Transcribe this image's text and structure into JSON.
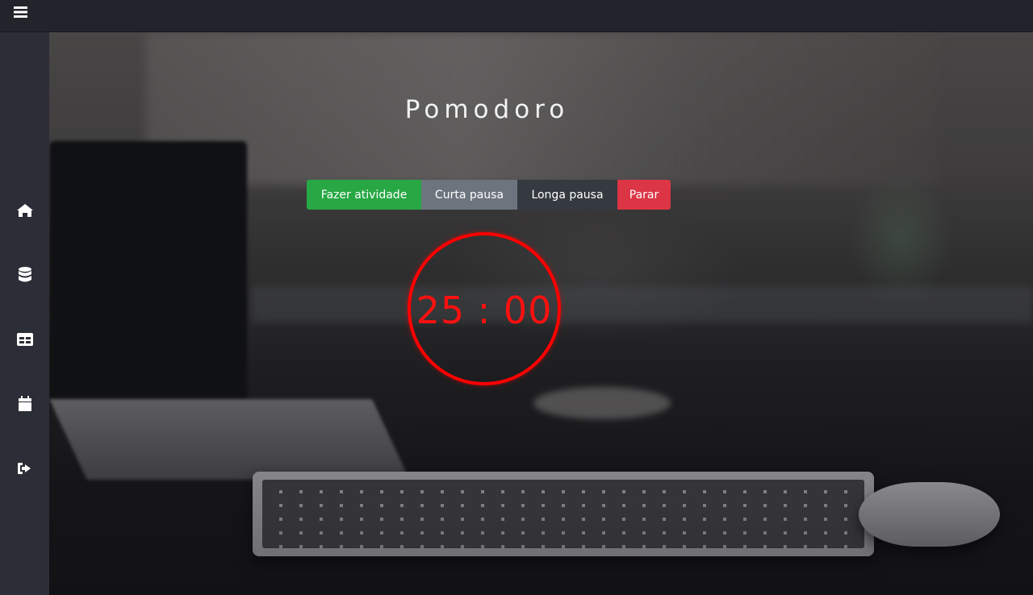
{
  "header": {
    "menu_icon": "hamburger-menu-icon"
  },
  "sidebar": {
    "items": [
      {
        "icon": "home-icon"
      },
      {
        "icon": "database-icon"
      },
      {
        "icon": "table-icon"
      },
      {
        "icon": "calendar-icon"
      },
      {
        "icon": "sign-out-icon"
      }
    ]
  },
  "main": {
    "title": "Pomodoro",
    "buttons": {
      "activity": "Fazer atividade",
      "short_break": "Curta pausa",
      "long_break": "Longa pausa",
      "stop": "Parar"
    },
    "timer": {
      "display": "25 : 00"
    }
  },
  "colors": {
    "activity": "#28a745",
    "short_break": "#6c757d",
    "long_break": "#343a40",
    "stop": "#dc3545",
    "timer": "#ff0000",
    "sidebar": "#2b2d37",
    "topbar": "#23242b"
  }
}
